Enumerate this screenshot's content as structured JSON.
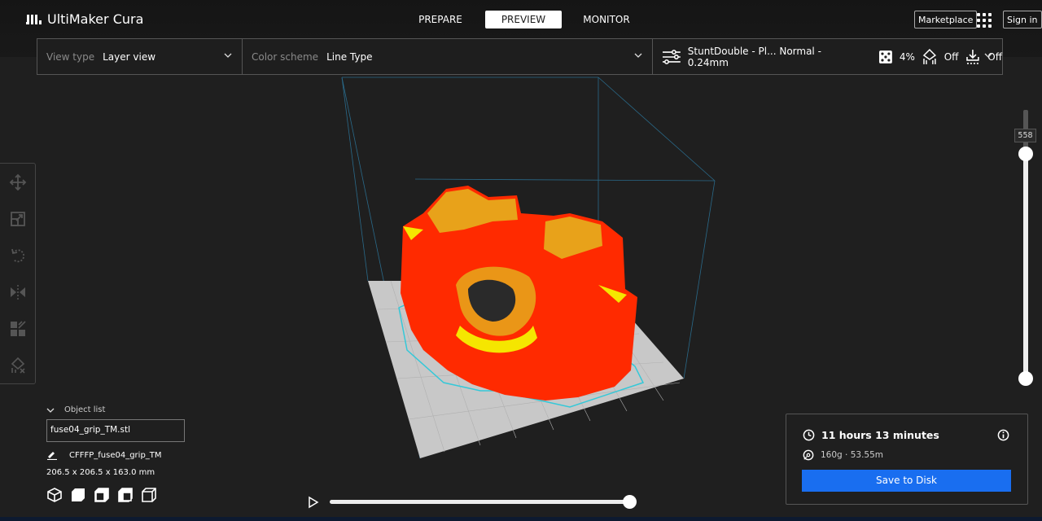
{
  "app": {
    "title": "UltiMaker Cura"
  },
  "stages": [
    {
      "label": "PREPARE",
      "active": false
    },
    {
      "label": "PREVIEW",
      "active": true
    },
    {
      "label": "MONITOR",
      "active": false
    }
  ],
  "header": {
    "marketplace": "Marketplace",
    "sign_in": "Sign in"
  },
  "toolbar": {
    "view_type_label": "View type",
    "view_type_value": "Layer view",
    "color_scheme_label": "Color scheme",
    "color_scheme_value": "Line Type",
    "profile": "StuntDouble - Pl... Normal - 0.24mm",
    "infill": "4%",
    "support": "Off",
    "adhesion": "Off"
  },
  "left_tools": [
    "move-icon",
    "scale-icon",
    "rotate-icon",
    "mirror-icon",
    "per-model-settings-icon",
    "support-blocker-icon"
  ],
  "object_list": {
    "header": "Object list",
    "file": "fuse04_grip_TM.stl",
    "object_name": "CFFFP_fuse04_grip_TM",
    "dimensions": "206.5 x 206.5 x 163.0 mm",
    "view_buttons": [
      "3d-view-icon",
      "front-view-icon",
      "top-view-icon",
      "left-view-icon",
      "right-view-icon"
    ]
  },
  "print_info": {
    "time": "11 hours 13 minutes",
    "material": "160g · 53.55m",
    "save_button": "Save to Disk"
  },
  "layer_slider": {
    "current_layer": "558",
    "max_layer": 558,
    "min_layer": 1
  },
  "path_slider": {
    "progress": 1.0
  },
  "colors": {
    "accent": "#196ef0",
    "wall": "#ff2a00",
    "infill": "#e8a21a",
    "skin": "#f5e600",
    "skirt": "#35c8d8",
    "build_plate": "#c8c8c8"
  }
}
